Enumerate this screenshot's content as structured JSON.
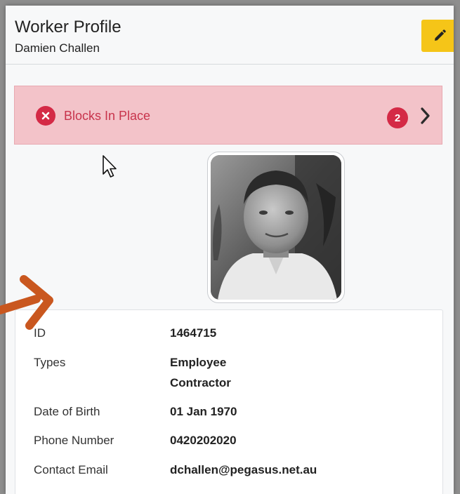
{
  "header": {
    "title": "Worker Profile",
    "subtitle": "Damien Challen",
    "edit_icon": "pencil-icon"
  },
  "blocks": {
    "label": "Blocks In Place",
    "count": "2",
    "status_icon": "x-circle-icon",
    "nav_icon": "chevron-right-icon"
  },
  "photo": {
    "description_icon": "profile-photo"
  },
  "details": {
    "rows": [
      {
        "label": "ID",
        "values": [
          "1464715"
        ]
      },
      {
        "label": "Types",
        "values": [
          "Employee",
          "Contractor"
        ]
      },
      {
        "label": "Date of Birth",
        "values": [
          "01 Jan 1970"
        ]
      },
      {
        "label": "Phone Number",
        "values": [
          "0420202020"
        ]
      },
      {
        "label": "Contact Email",
        "values": [
          "dchallen@pegasus.net.au"
        ]
      }
    ]
  },
  "colors": {
    "accent_yellow": "#f5c518",
    "block_bg": "#f3c3c9",
    "block_red": "#d42a46",
    "annotation_arrow": "#c9571f"
  }
}
